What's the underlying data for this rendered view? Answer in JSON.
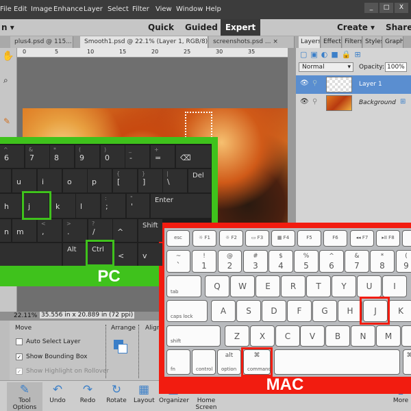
{
  "menu": [
    "File",
    "Edit",
    "Image",
    "Enhance",
    "Layer",
    "Select",
    "Filter",
    "View",
    "Window",
    "Help"
  ],
  "window_buttons": [
    "_",
    "□",
    "X"
  ],
  "modes": {
    "left": "n ▾",
    "quick": "Quick",
    "guided": "Guided",
    "expert": "Expert",
    "create": "Create ▾",
    "share": "Share"
  },
  "doc_tabs": [
    "plus4.psd @ 115... ×",
    "Smooth1.psd @ 22.1% (Layer 1, RGB/8) * ×",
    "screenshots.psd ... ×"
  ],
  "panel_tabs": [
    "Layers",
    "Effect",
    "Filters",
    "Styles",
    "Graph"
  ],
  "ruler_ticks": [
    "0",
    "5",
    "10",
    "15",
    "20",
    "25",
    "30",
    "35"
  ],
  "layers_panel": {
    "blend_mode": "Normal",
    "opacity_label": "Opacity:",
    "opacity_value": "100%",
    "layers": [
      {
        "name": "Layer 1",
        "selected": true
      },
      {
        "name": "Background",
        "selected": false
      }
    ]
  },
  "status": {
    "zoom": "22.11%",
    "doc_size": "35.556 in x 20.889 in (72 ppi)"
  },
  "tool_options": {
    "move_label": "Move",
    "arrange_label": "Arrange",
    "align_label": "Align",
    "options": [
      {
        "label": "Auto Select Layer",
        "checked": false
      },
      {
        "label": "Show Bounding Box",
        "checked": true
      },
      {
        "label": "Show Highlight on Rollover",
        "checked": true
      }
    ]
  },
  "bottom_bar": [
    {
      "label": "Tool Options",
      "icon": "pencil-list-icon"
    },
    {
      "label": "Undo",
      "icon": "undo-icon"
    },
    {
      "label": "Redo",
      "icon": "redo-icon"
    },
    {
      "label": "Rotate",
      "icon": "rotate-icon"
    },
    {
      "label": "Layout",
      "icon": "layout-icon"
    },
    {
      "label": "Organizer",
      "icon": "organizer-icon"
    },
    {
      "label": "Home Screen",
      "icon": "home-icon"
    },
    {
      "label": "More",
      "icon": "more-icon"
    }
  ],
  "pc_keyboard": {
    "label": "PC",
    "accent": "#3fc21c",
    "rows": [
      [
        [
          "^",
          "6"
        ],
        [
          "&",
          "7"
        ],
        [
          "*",
          "8"
        ],
        [
          "(",
          "9"
        ],
        [
          ")",
          "0"
        ],
        [
          "_",
          "-"
        ],
        [
          "+",
          "="
        ],
        [
          "",
          "⌫"
        ]
      ],
      [
        [
          "",
          ""
        ],
        [
          "",
          "u"
        ],
        [
          "",
          "i"
        ],
        [
          "",
          "o"
        ],
        [
          "",
          "p"
        ],
        [
          "{",
          "["
        ],
        [
          "}",
          "]"
        ],
        [
          "|",
          "\\"
        ],
        [
          "",
          "Del"
        ]
      ],
      [
        [
          "",
          "h"
        ],
        [
          "",
          "j"
        ],
        [
          "",
          "k"
        ],
        [
          "",
          "l"
        ],
        [
          ":",
          ";"
        ],
        [
          "\"",
          "'"
        ],
        [
          "",
          "Enter"
        ]
      ],
      [
        [
          "",
          "n"
        ],
        [
          "",
          "m"
        ],
        [
          "<",
          ","
        ],
        [
          ">",
          "."
        ],
        [
          "?",
          "/"
        ],
        [
          "",
          "^"
        ],
        [
          "",
          "Shift"
        ]
      ],
      [
        [
          "",
          ""
        ],
        [
          "",
          "Alt"
        ],
        [
          "",
          "Ctrl"
        ],
        [
          "",
          "<"
        ],
        [
          "",
          "v"
        ]
      ]
    ]
  },
  "mac_keyboard": {
    "label": "MAC",
    "accent": "#f21c10",
    "rows": [
      [
        [
          "",
          "esc"
        ],
        [
          "",
          "☼ F1"
        ],
        [
          "",
          "☼ F2"
        ],
        [
          "",
          "▭ F3"
        ],
        [
          "",
          "▦ F4"
        ],
        [
          "",
          "F5"
        ],
        [
          "",
          "F6"
        ],
        [
          "",
          "◂◂ F7"
        ],
        [
          "",
          "▸II F8"
        ],
        [
          "",
          ""
        ]
      ],
      [
        [
          "~",
          "`"
        ],
        [
          "!",
          "1"
        ],
        [
          "@",
          "2"
        ],
        [
          "#",
          "3"
        ],
        [
          "$",
          "4"
        ],
        [
          "%",
          "5"
        ],
        [
          "^",
          "6"
        ],
        [
          "&",
          "7"
        ],
        [
          "*",
          "8"
        ],
        [
          "(",
          "9"
        ]
      ],
      [
        [
          "",
          "tab"
        ],
        [
          "",
          "Q"
        ],
        [
          "",
          "W"
        ],
        [
          "",
          "E"
        ],
        [
          "",
          "R"
        ],
        [
          "",
          "T"
        ],
        [
          "",
          "Y"
        ],
        [
          "",
          "U"
        ],
        [
          "",
          "I"
        ]
      ],
      [
        [
          "",
          "caps lock"
        ],
        [
          "",
          "A"
        ],
        [
          "",
          "S"
        ],
        [
          "",
          "D"
        ],
        [
          "",
          "F"
        ],
        [
          "",
          "G"
        ],
        [
          "",
          "H"
        ],
        [
          "",
          "J"
        ],
        [
          "",
          "K"
        ]
      ],
      [
        [
          "",
          "shift"
        ],
        [
          "",
          "Z"
        ],
        [
          "",
          "X"
        ],
        [
          "",
          "C"
        ],
        [
          "",
          "V"
        ],
        [
          "",
          "B"
        ],
        [
          "",
          "N"
        ],
        [
          "",
          "M"
        ],
        [
          "",
          ""
        ]
      ],
      [
        [
          "",
          "fn"
        ],
        [
          "",
          "control"
        ],
        [
          "alt",
          "option"
        ],
        [
          "⌘",
          "command"
        ],
        [
          "",
          ""
        ],
        [
          "⌘",
          ""
        ]
      ]
    ]
  }
}
